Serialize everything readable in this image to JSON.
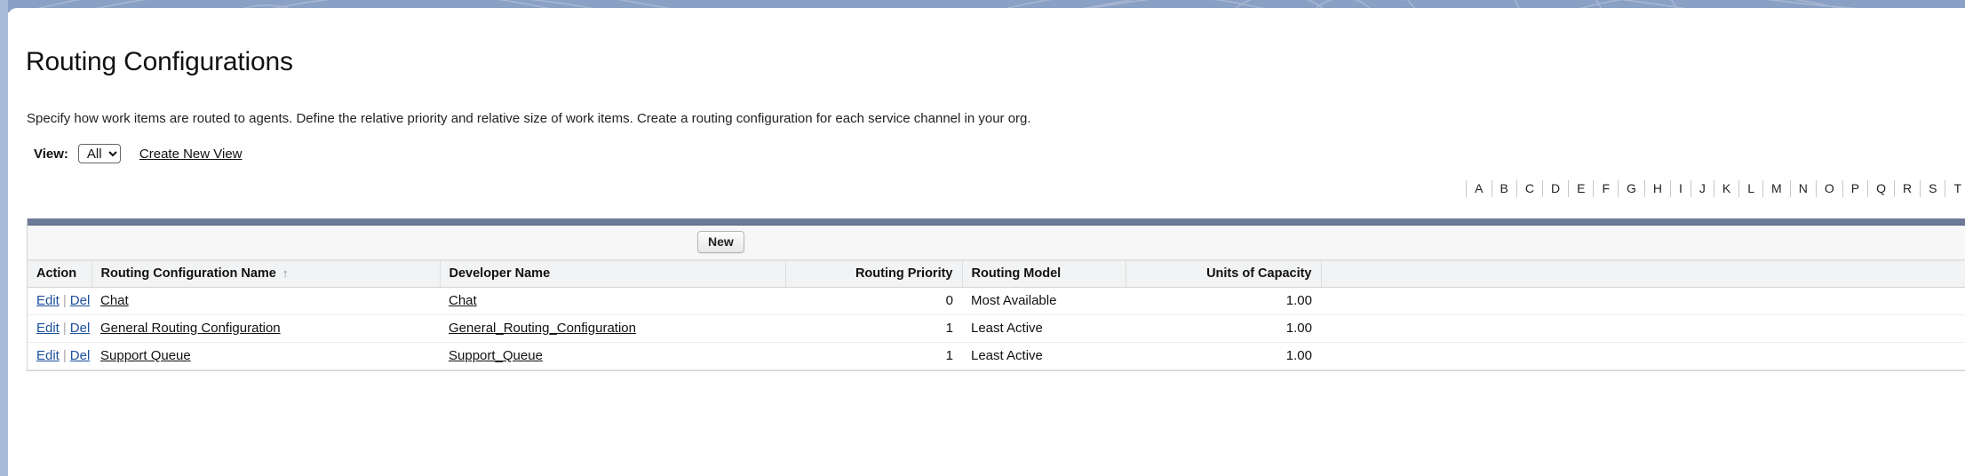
{
  "page": {
    "title": "Routing Configurations",
    "description": "Specify how work items are routed to agents. Define the relative priority and relative size of work items. Create a routing configuration for each service channel in your org."
  },
  "view_filter": {
    "label": "View:",
    "selected": "All",
    "options": [
      "All"
    ],
    "create_new_view_link": "Create New View"
  },
  "alphabet_filter": {
    "letters": [
      "A",
      "B",
      "C",
      "D",
      "E",
      "F",
      "G",
      "H",
      "I",
      "J",
      "K",
      "L",
      "M",
      "N",
      "O",
      "P",
      "Q",
      "R",
      "S",
      "T"
    ]
  },
  "toolbar": {
    "new_label": "New"
  },
  "table": {
    "sort_column": "Routing Configuration Name",
    "sort_direction": "asc",
    "sort_indicator": "↑",
    "headers": {
      "action": "Action",
      "name": "Routing Configuration Name",
      "developer_name": "Developer Name",
      "routing_priority": "Routing Priority",
      "routing_model": "Routing Model",
      "units_of_capacity": "Units of Capacity"
    },
    "action_labels": {
      "edit": "Edit",
      "separator": "|",
      "delete": "Del"
    },
    "rows": [
      {
        "name": "Chat",
        "developer_name": "Chat",
        "routing_priority": "0",
        "routing_model": "Most Available",
        "units_of_capacity": "1.00"
      },
      {
        "name": "General Routing Configuration",
        "developer_name": "General_Routing_Configuration",
        "routing_priority": "1",
        "routing_model": "Least Active",
        "units_of_capacity": "1.00"
      },
      {
        "name": "Support Queue",
        "developer_name": "Support_Queue",
        "routing_priority": "1",
        "routing_model": "Least Active",
        "units_of_capacity": "1.00"
      }
    ]
  },
  "colors": {
    "banner": "#8aa0c4",
    "list_topbar": "#6d7a99",
    "link": "#1b4f9c",
    "header_bg": "#f2f3f4"
  }
}
